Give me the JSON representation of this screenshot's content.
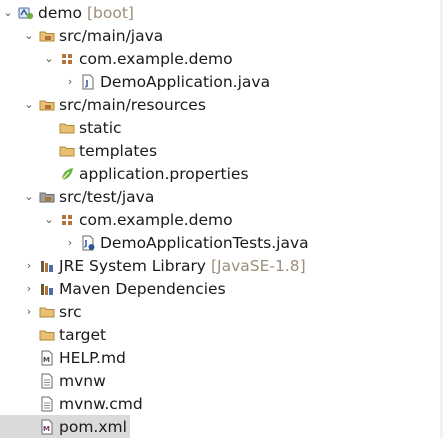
{
  "tree": {
    "items": [
      {
        "label": "demo",
        "decoration": "[boot]",
        "icon": "boot-project-icon",
        "expanded": true
      },
      {
        "label": "src/main/java",
        "icon": "source-folder-icon",
        "expanded": true
      },
      {
        "label": "com.example.demo",
        "icon": "package-icon",
        "expanded": true
      },
      {
        "label": "DemoApplication.java",
        "icon": "java-file-icon",
        "expanded": false
      },
      {
        "label": "src/main/resources",
        "icon": "source-folder-icon",
        "expanded": true
      },
      {
        "label": "static",
        "icon": "folder-icon"
      },
      {
        "label": "templates",
        "icon": "folder-icon"
      },
      {
        "label": "application.properties",
        "icon": "spring-properties-icon"
      },
      {
        "label": "src/test/java",
        "icon": "test-source-folder-icon",
        "expanded": true
      },
      {
        "label": "com.example.demo",
        "icon": "package-icon",
        "expanded": true
      },
      {
        "label": "DemoApplicationTests.java",
        "icon": "java-test-file-icon",
        "expanded": false
      },
      {
        "label": "JRE System Library",
        "decoration": "[JavaSE-1.8]",
        "icon": "library-icon",
        "expanded": false
      },
      {
        "label": "Maven Dependencies",
        "icon": "library-icon",
        "expanded": false
      },
      {
        "label": "src",
        "icon": "folder-icon",
        "expanded": false
      },
      {
        "label": "target",
        "icon": "folder-icon"
      },
      {
        "label": "HELP.md",
        "icon": "markdown-file-icon"
      },
      {
        "label": "mvnw",
        "icon": "text-file-icon"
      },
      {
        "label": "mvnw.cmd",
        "icon": "text-file-icon"
      },
      {
        "label": "pom.xml",
        "icon": "maven-pom-icon",
        "selected": true
      }
    ]
  },
  "colors": {
    "folder": "#e8c074",
    "package": "#b0743a",
    "spring_green": "#6db33f",
    "decoration": "#9c8e7a",
    "selection": "#dadada"
  }
}
